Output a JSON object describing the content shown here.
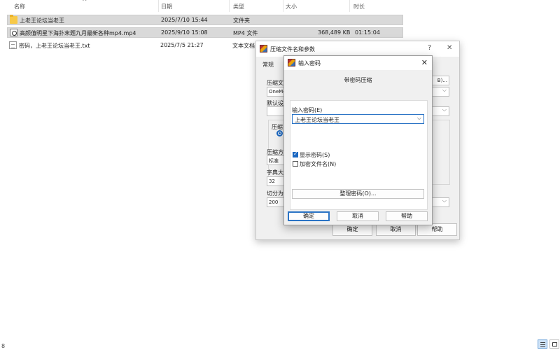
{
  "explorer": {
    "columns": {
      "name": "名称",
      "date": "日期",
      "type": "类型",
      "size": "大小",
      "duration": "时长"
    },
    "files": [
      {
        "icon": "folder-icon",
        "name": "上老王论坛当老王",
        "date": "2025/7/10 15:44",
        "type": "文件夹",
        "size": "",
        "duration": "",
        "selected": true
      },
      {
        "icon": "video-file-icon",
        "name": "高颜值明星下海扑末题九月最新各种mp4.mp4",
        "date": "2025/9/10 15:08",
        "type": "MP4 文件",
        "size": "368,489 KB",
        "duration": "01:15:04",
        "selected": true
      },
      {
        "icon": "text-file-icon",
        "name": "密码，上老王论坛当老王.txt",
        "date": "2025/7/5 21:27",
        "type": "文本文档",
        "size": "",
        "duration": "",
        "selected": false
      }
    ]
  },
  "archive_dialog": {
    "title": "压缩文件名和参数",
    "help_glyph": "?",
    "close_glyph": "✕",
    "tab_general": "常规",
    "archive_name_label": "压缩文",
    "archive_name_value": "OneMo",
    "browse_button": "B)...",
    "default_label": "默认设",
    "format_label": "压缩",
    "method_label": "压缩方",
    "method_value": "标准",
    "dict_label": "字典大",
    "dict_value": "32",
    "split_label": "切分为",
    "split_value": "200",
    "ok": "确定",
    "cancel": "取消",
    "help": "帮助"
  },
  "password_dialog": {
    "title": "输入密码",
    "close_glyph": "✕",
    "subtitle": "带密码压缩",
    "password_label": "输入密码(E)",
    "password_value": "上老王论坛当老王",
    "show_password_label": "显示密码(S)",
    "show_password_checked": true,
    "encrypt_names_label": "加密文件名(N)",
    "encrypt_names_checked": false,
    "organize_button": "整理密码(O)...",
    "ok": "确定",
    "cancel": "取消",
    "help": "帮助"
  },
  "statusbar": {
    "left_marker": "8"
  }
}
